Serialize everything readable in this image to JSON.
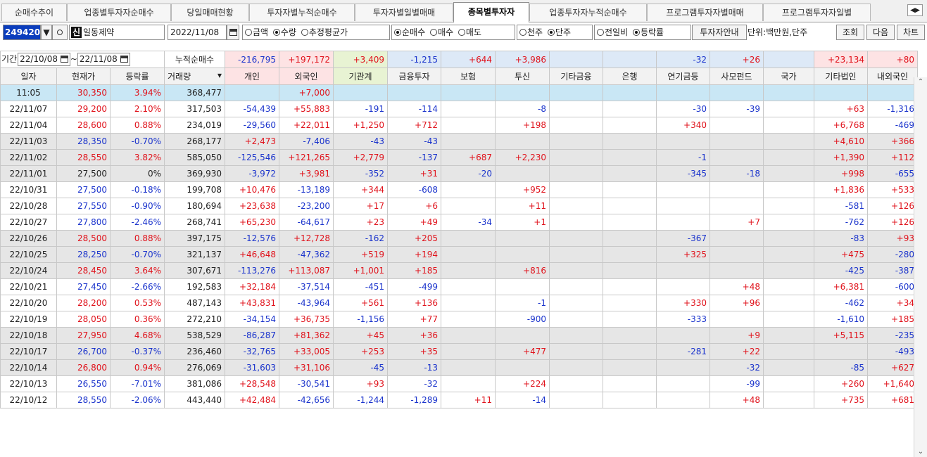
{
  "tabs": [
    {
      "label": "순매수추이"
    },
    {
      "label": "업종별투자자순매수"
    },
    {
      "label": "당일매매현황"
    },
    {
      "label": "투자자별누적순매수"
    },
    {
      "label": "투자자별일별매매"
    },
    {
      "label": "종목별투자자",
      "active": true
    },
    {
      "label": "업종투자자누적순매수"
    },
    {
      "label": "프로그램투자자별매매"
    },
    {
      "label": "프로그램투자자일별"
    }
  ],
  "toolbar": {
    "stock_code": "249420",
    "badge": "신",
    "stock_name": "일동제약",
    "date": "2022/11/08",
    "opt_amount": "금액",
    "opt_qty": "수량",
    "opt_avg": "추정평균가",
    "opt_net": "순매수",
    "opt_buy": "매수",
    "opt_sell": "매도",
    "opt_thousand": "천주",
    "opt_single": "단주",
    "opt_prev": "전일비",
    "opt_rate": "등락률",
    "guide": "투자자안내",
    "unit": "단위:백만원,단주",
    "btn_query": "조회",
    "btn_next": "다음",
    "btn_chart": "차트"
  },
  "period": {
    "label": "기간",
    "from": "22/10/08",
    "tilde": "~",
    "to": "22/11/08",
    "cum_label": "누적순매수",
    "cum_values": [
      "-216,795",
      "+197,172",
      "+3,409",
      "-1,215",
      "+644",
      "+3,986",
      "",
      "",
      "-32",
      "+26",
      "",
      "+23,134",
      "+80"
    ]
  },
  "headers": [
    "일자",
    "현재가",
    "등락률",
    "거래량",
    "개인",
    "외국인",
    "기관계",
    "금융투자",
    "보험",
    "투신",
    "기타금융",
    "은행",
    "연기금등",
    "사모펀드",
    "국가",
    "기타법인",
    "내외국인"
  ],
  "rows": [
    {
      "c": [
        "11:05",
        "30,350",
        "3.94%",
        "368,477",
        "",
        "+7,000",
        "",
        "",
        "",
        "",
        "",
        "",
        "",
        "",
        "",
        "",
        ""
      ]
    },
    {
      "c": [
        "22/11/07",
        "29,200",
        "2.10%",
        "317,503",
        "-54,439",
        "+55,883",
        "-191",
        "-114",
        "",
        "-8",
        "",
        "",
        "-30",
        "-39",
        "",
        "+63",
        "-1,316"
      ]
    },
    {
      "c": [
        "22/11/04",
        "28,600",
        "0.88%",
        "234,019",
        "-29,560",
        "+22,011",
        "+1,250",
        "+712",
        "",
        "+198",
        "",
        "",
        "+340",
        "",
        "",
        "+6,768",
        "-469"
      ]
    },
    {
      "c": [
        "22/11/03",
        "28,350",
        "-0.70%",
        "268,177",
        "+2,473",
        "-7,406",
        "-43",
        "-43",
        "",
        "",
        "",
        "",
        "",
        "",
        "",
        "+4,610",
        "+366"
      ]
    },
    {
      "c": [
        "22/11/02",
        "28,550",
        "3.82%",
        "585,050",
        "-125,546",
        "+121,265",
        "+2,779",
        "-137",
        "+687",
        "+2,230",
        "",
        "",
        "-1",
        "",
        "",
        "+1,390",
        "+112"
      ]
    },
    {
      "c": [
        "22/11/01",
        "27,500",
        "0%",
        "369,930",
        "-3,972",
        "+3,981",
        "-352",
        "+31",
        "-20",
        "",
        "",
        "",
        "-345",
        "-18",
        "",
        "+998",
        "-655"
      ]
    },
    {
      "c": [
        "22/10/31",
        "27,500",
        "-0.18%",
        "199,708",
        "+10,476",
        "-13,189",
        "+344",
        "-608",
        "",
        "+952",
        "",
        "",
        "",
        "",
        "",
        "+1,836",
        "+533"
      ]
    },
    {
      "c": [
        "22/10/28",
        "27,550",
        "-0.90%",
        "180,694",
        "+23,638",
        "-23,200",
        "+17",
        "+6",
        "",
        "+11",
        "",
        "",
        "",
        "",
        "",
        "-581",
        "+126"
      ]
    },
    {
      "c": [
        "22/10/27",
        "27,800",
        "-2.46%",
        "268,741",
        "+65,230",
        "-64,617",
        "+23",
        "+49",
        "-34",
        "+1",
        "",
        "",
        "",
        "+7",
        "",
        "-762",
        "+126"
      ]
    },
    {
      "c": [
        "22/10/26",
        "28,500",
        "0.88%",
        "397,175",
        "-12,576",
        "+12,728",
        "-162",
        "+205",
        "",
        "",
        "",
        "",
        "-367",
        "",
        "",
        "-83",
        "+93"
      ]
    },
    {
      "c": [
        "22/10/25",
        "28,250",
        "-0.70%",
        "321,137",
        "+46,648",
        "-47,362",
        "+519",
        "+194",
        "",
        "",
        "",
        "",
        "+325",
        "",
        "",
        "+475",
        "-280"
      ]
    },
    {
      "c": [
        "22/10/24",
        "28,450",
        "3.64%",
        "307,671",
        "-113,276",
        "+113,087",
        "+1,001",
        "+185",
        "",
        "+816",
        "",
        "",
        "",
        "",
        "",
        "-425",
        "-387"
      ]
    },
    {
      "c": [
        "22/10/21",
        "27,450",
        "-2.66%",
        "192,583",
        "+32,184",
        "-37,514",
        "-451",
        "-499",
        "",
        "",
        "",
        "",
        "",
        "+48",
        "",
        "+6,381",
        "-600"
      ]
    },
    {
      "c": [
        "22/10/20",
        "28,200",
        "0.53%",
        "487,143",
        "+43,831",
        "-43,964",
        "+561",
        "+136",
        "",
        "-1",
        "",
        "",
        "+330",
        "+96",
        "",
        "-462",
        "+34"
      ]
    },
    {
      "c": [
        "22/10/19",
        "28,050",
        "0.36%",
        "272,210",
        "-34,154",
        "+36,735",
        "-1,156",
        "+77",
        "",
        "-900",
        "",
        "",
        "-333",
        "",
        "",
        "-1,610",
        "+185"
      ]
    },
    {
      "c": [
        "22/10/18",
        "27,950",
        "4.68%",
        "538,529",
        "-86,287",
        "+81,362",
        "+45",
        "+36",
        "",
        "",
        "",
        "",
        "",
        "+9",
        "",
        "+5,115",
        "-235"
      ]
    },
    {
      "c": [
        "22/10/17",
        "26,700",
        "-0.37%",
        "236,460",
        "-32,765",
        "+33,005",
        "+253",
        "+35",
        "",
        "+477",
        "",
        "",
        "-281",
        "+22",
        "",
        "",
        "-493"
      ]
    },
    {
      "c": [
        "22/10/14",
        "26,800",
        "0.94%",
        "276,069",
        "-31,603",
        "+31,106",
        "-45",
        "-13",
        "",
        "",
        "",
        "",
        "",
        "-32",
        "",
        "-85",
        "+627"
      ]
    },
    {
      "c": [
        "22/10/13",
        "26,550",
        "-7.01%",
        "381,086",
        "+28,548",
        "-30,541",
        "+93",
        "-32",
        "",
        "+224",
        "",
        "",
        "",
        "-99",
        "",
        "+260",
        "+1,640"
      ]
    },
    {
      "c": [
        "22/10/12",
        "28,550",
        "-2.06%",
        "443,440",
        "+42,484",
        "-42,656",
        "-1,244",
        "-1,289",
        "+11",
        "-14",
        "",
        "",
        "",
        "+48",
        "",
        "+735",
        "+681"
      ]
    }
  ],
  "colors": {
    "up": "#e0121b",
    "down": "#1a33cc",
    "live_row": "#c9e7f5",
    "gray_row": "#e6e6e6"
  }
}
